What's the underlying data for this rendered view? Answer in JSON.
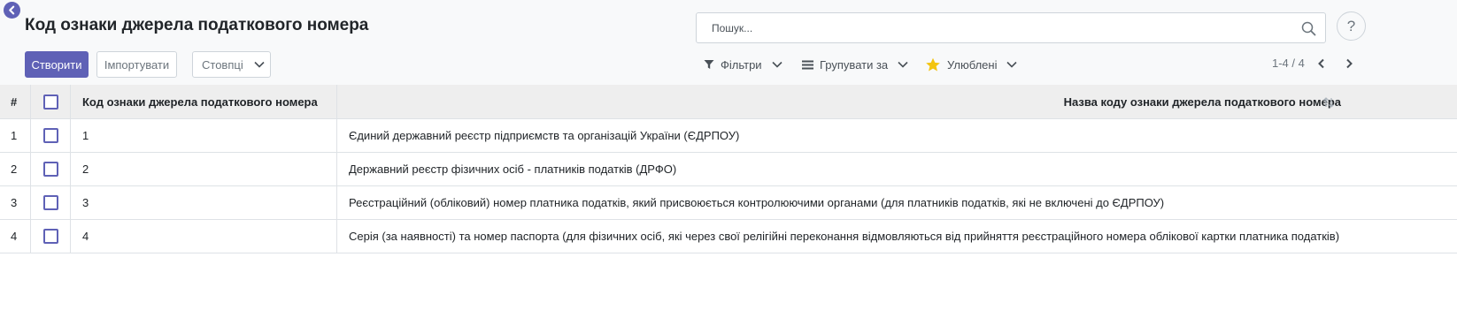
{
  "header": {
    "title": "Код ознаки джерела податкового номера",
    "back_icon": "chevron-left-icon"
  },
  "buttons": {
    "create": "Створити",
    "import": "Імпортувати",
    "columns": "Стовпці"
  },
  "search": {
    "placeholder": "Пошук...",
    "value": ""
  },
  "help": {
    "label": "?"
  },
  "filters": {
    "filters_label": "Фільтри",
    "group_by_label": "Групувати за",
    "favorites_label": "Улюблені"
  },
  "pager": {
    "text": "1-4 / 4"
  },
  "table": {
    "columns": {
      "num": "#",
      "code": "Код ознаки джерела податкового номера",
      "name": "Назва коду ознаки джерела податкового номера"
    },
    "rows": [
      {
        "num": "1",
        "code": "1",
        "name": "Єдиний державний реєстр підприємств та організацій України (ЄДРПОУ)"
      },
      {
        "num": "2",
        "code": "2",
        "name": "Державний реєстр фізичних осіб - платників податків (ДРФО)"
      },
      {
        "num": "3",
        "code": "3",
        "name": "Реєстраційний (обліковий) номер платника податків, який присвоюється контролюючими органами (для платників податків, які не включені до ЄДРПОУ)"
      },
      {
        "num": "4",
        "code": "4",
        "name": "Серія (за наявності) та номер паспорта (для фізичних осіб, які через свої релігійні переконання відмовляються від прийняття реєстраційного номера облікової картки платника податків)"
      }
    ]
  },
  "colors": {
    "accent": "#5f61b6",
    "star": "#f3c40f",
    "header_bg": "#eeeeee",
    "panel_bg": "#f8f9fa"
  }
}
